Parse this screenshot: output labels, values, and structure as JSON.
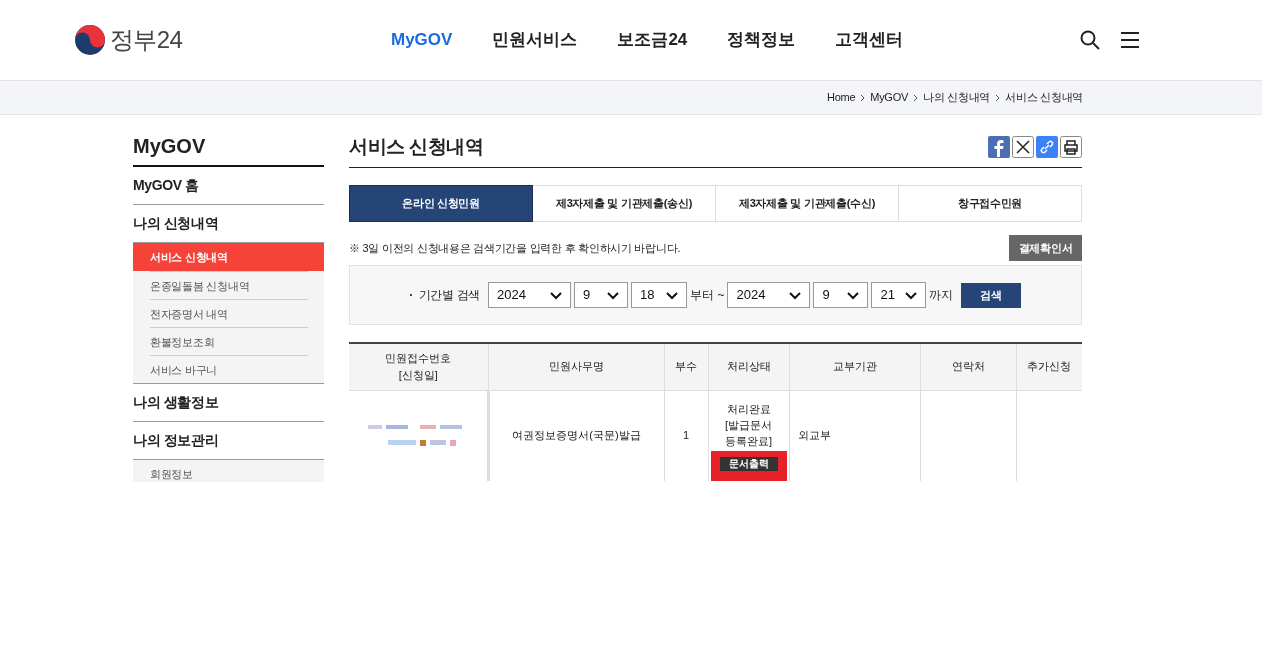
{
  "header": {
    "logo_text": "정부24",
    "nav": [
      {
        "label": "MyGOV",
        "selected": true
      },
      {
        "label": "민원서비스",
        "selected": false
      },
      {
        "label": "보조금24",
        "selected": false
      },
      {
        "label": "정책정보",
        "selected": false
      },
      {
        "label": "고객센터",
        "selected": false
      }
    ]
  },
  "breadcrumb": [
    "Home",
    "MyGOV",
    "나의 신청내역",
    "서비스 신청내역"
  ],
  "sidebar": {
    "title": "MyGOV",
    "sections": [
      {
        "label": "MyGOV 홈"
      },
      {
        "label": "나의 신청내역",
        "children": [
          {
            "label": "서비스 신청내역",
            "selected": true
          },
          {
            "label": "온종일돌봄 신청내역",
            "selected": false
          },
          {
            "label": "전자증명서 내역",
            "selected": false
          },
          {
            "label": "환불정보조회",
            "selected": false
          },
          {
            "label": "서비스 바구니",
            "selected": false
          }
        ]
      },
      {
        "label": "나의 생활정보"
      },
      {
        "label": "나의 정보관리",
        "children": [
          {
            "label": "회원정보",
            "selected": false
          }
        ]
      }
    ]
  },
  "page_title": "서비스 신청내역",
  "tabs": [
    {
      "label": "온라인 신청민원",
      "selected": true
    },
    {
      "label": "제3자제출 및 기관제출(송신)",
      "selected": false
    },
    {
      "label": "제3자제출 및 기관제출(수신)",
      "selected": false
    },
    {
      "label": "창구접수민원",
      "selected": false
    }
  ],
  "notice": "※ 3일 이전의 신청내용은 검색기간을 입력한 후 확인하시기 바랍니다.",
  "receipt_button": "결제확인서",
  "search": {
    "label": "기간별 검색",
    "from": [
      "2024",
      "9",
      "18"
    ],
    "from_suffix": "부터 ~",
    "to": [
      "2024",
      "9",
      "21"
    ],
    "to_suffix": "까지",
    "button": "검색"
  },
  "table": {
    "columns": [
      "민원접수번호\n[신청일]",
      "민원사무명",
      "부수",
      "처리상태",
      "교부기관",
      "연락처",
      "추가신청"
    ],
    "rows": [
      {
        "service": "여권정보증명서(국문)발급",
        "copies": "1",
        "status": "처리완료\n[발급문서\n등록완료]",
        "print_button": "문서출력",
        "agency": "외교부"
      }
    ]
  }
}
